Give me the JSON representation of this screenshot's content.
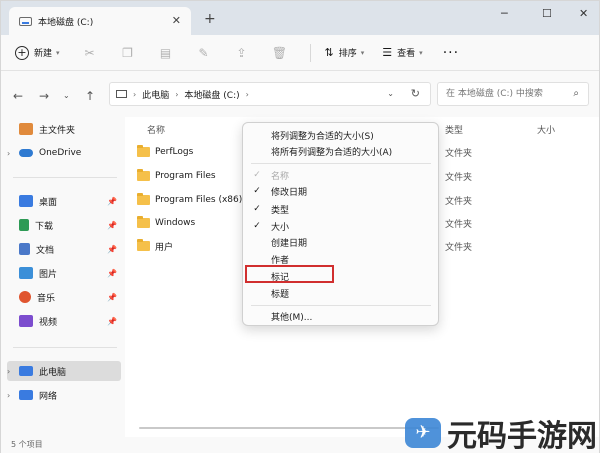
{
  "window": {
    "tab_title": "本地磁盘 (C:)",
    "new_tab_symbol": "+",
    "controls": [
      "─",
      "☐",
      "✕"
    ]
  },
  "toolbar": {
    "new_label": "新建",
    "sort_label": "排序",
    "view_label": "查看",
    "more_label": "···"
  },
  "address": {
    "crumbs": [
      "此电脑",
      "本地磁盘 (C:)"
    ],
    "search_placeholder": "在 本地磁盘 (C:) 中搜索"
  },
  "sidebar": {
    "items": [
      {
        "label": "主文件夹",
        "icon": "home-icon",
        "color": "#e08a3c"
      },
      {
        "label": "OneDrive",
        "icon": "cloud-icon",
        "color": "#2f7ad1"
      },
      {
        "label": "桌面",
        "icon": "desktop-icon",
        "color": "#3a7be0"
      },
      {
        "label": "下载",
        "icon": "download-icon",
        "color": "#2d9a55"
      },
      {
        "label": "文档",
        "icon": "document-icon",
        "color": "#4a78c8"
      },
      {
        "label": "图片",
        "icon": "picture-icon",
        "color": "#3b8fd8"
      },
      {
        "label": "音乐",
        "icon": "music-icon",
        "color": "#e0552f"
      },
      {
        "label": "视频",
        "icon": "video-icon",
        "color": "#7c4dce"
      },
      {
        "label": "此电脑",
        "icon": "computer-icon",
        "color": "#3a7be0"
      },
      {
        "label": "网络",
        "icon": "network-icon",
        "color": "#3a7be0"
      }
    ]
  },
  "columns": {
    "name": "名称",
    "type": "类型",
    "size": "大小"
  },
  "files": [
    {
      "name": "PerfLogs",
      "type": "文件夹"
    },
    {
      "name": "Program Files",
      "type": "文件夹"
    },
    {
      "name": "Program Files (x86)",
      "type": "文件夹"
    },
    {
      "name": "Windows",
      "type": "文件夹"
    },
    {
      "name": "用户",
      "type": "文件夹"
    }
  ],
  "context_menu": {
    "size_one": "将列调整为合适的大小(S)",
    "size_all": "将所有列调整为合适的大小(A)",
    "columns": [
      {
        "label": "名称",
        "checked": true,
        "disabled": true
      },
      {
        "label": "修改日期",
        "checked": true,
        "disabled": false
      },
      {
        "label": "类型",
        "checked": true,
        "disabled": false
      },
      {
        "label": "大小",
        "checked": true,
        "disabled": false
      },
      {
        "label": "创建日期",
        "checked": false,
        "disabled": false
      },
      {
        "label": "作者",
        "checked": false,
        "disabled": false
      },
      {
        "label": "标记",
        "checked": false,
        "disabled": false
      },
      {
        "label": "标题",
        "checked": false,
        "disabled": false
      }
    ],
    "more": "其他(M)...",
    "check_glyph": "✓"
  },
  "status": {
    "item_count": "5 个项目"
  },
  "watermark": {
    "text": "元码手游网",
    "bird_glyph": "✈"
  },
  "highlight_color": "#d12f2f"
}
